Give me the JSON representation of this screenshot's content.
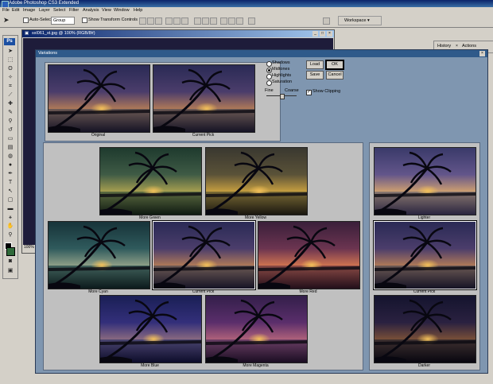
{
  "app": {
    "title": "Adobe Photoshop CS3 Extended"
  },
  "menu": [
    "File",
    "Edit",
    "Image",
    "Layer",
    "Select",
    "Filter",
    "Analysis",
    "View",
    "Window",
    "Help"
  ],
  "options": {
    "auto_select_label": "Auto-Select:",
    "auto_select_value": "Group",
    "show_transform_label": "Show Transform Controls",
    "workspace_label": "Workspace"
  },
  "document": {
    "title": "sxl061_st.jpg @ 100% (RGB/8#)",
    "zoom": "100%"
  },
  "panels": {
    "history_tab": "History",
    "actions_tab": "Actions"
  },
  "dialog": {
    "title": "Variations",
    "original_label": "Original",
    "current_pick_top_label": "Current Pick",
    "radio_options": [
      "Shadows",
      "Midtones",
      "Highlights",
      "Saturation"
    ],
    "selected_radio": "Midtones",
    "fine_label": "Fine",
    "coarse_label": "Coarse",
    "show_clipping_label": "Show Clipping",
    "buttons": {
      "load": "Load",
      "save": "Save",
      "ok": "OK",
      "cancel": "Cancel"
    },
    "variations": {
      "more_green": "More Green",
      "more_yellow": "More Yellow",
      "more_cyan": "More Cyan",
      "current_pick": "Current Pick",
      "more_red": "More Red",
      "more_blue": "More Blue",
      "more_magenta": "More Magenta"
    },
    "lightness": {
      "lighter": "Lighter",
      "current_pick": "Current Pick",
      "darker": "Darker"
    }
  },
  "colors": {
    "desktop": "#3a6ea5",
    "dialog_bg": "#7f96b0",
    "pane_bg": "#c0c0c0",
    "sun": "#f3c15a"
  }
}
